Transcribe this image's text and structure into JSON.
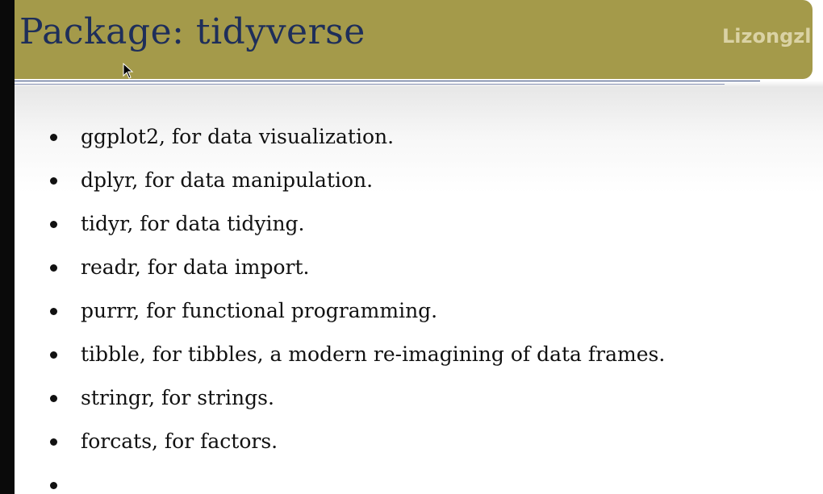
{
  "slide": {
    "title": "Package:  tidyverse",
    "watermark": "Lizongzl"
  },
  "bullets": [
    "ggplot2, for data visualization.",
    "dplyr, for data manipulation.",
    "tidyr, for data tidying.",
    "readr, for data import.",
    "purrr, for functional programming.",
    "tibble, for tibbles, a modern re-imagining of data frames.",
    "stringr, for strings.",
    "forcats, for factors.",
    ""
  ],
  "colors": {
    "title_bar": "#a49a4a",
    "title_text": "#1e2e5a",
    "body_text": "#111111"
  }
}
